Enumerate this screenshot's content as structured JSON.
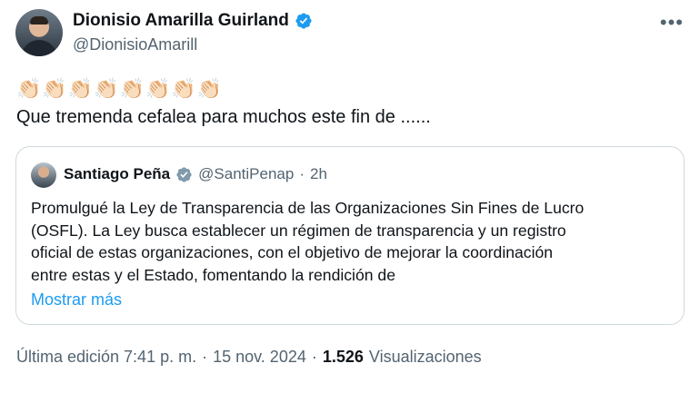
{
  "author": {
    "name": "Dionisio Amarilla Guirland",
    "handle": "@DionisioAmarill"
  },
  "tweet": {
    "emojis": "👏🏻👏🏻👏🏻👏🏻👏🏻👏🏻👏🏻👏🏻",
    "text": "Que tremenda cefalea para muchos este fin de ......"
  },
  "quote": {
    "name": "Santiago Peña",
    "handle": "@SantiPenap",
    "dot": "·",
    "time": "2h",
    "lines": [
      "Promulgué la Ley de Transparencia de las Organizaciones Sin Fines de Lucro",
      "(OSFL). La Ley busca establecer un régimen de transparencia y un registro",
      "oficial de estas organizaciones, con el objetivo de mejorar la coordinación",
      "entre estas y el Estado, fomentando la rendición de"
    ],
    "show_more": "Mostrar más"
  },
  "meta": {
    "edited": "Última edición 7:41 p. m.",
    "sep1": "·",
    "date": "15 nov. 2024",
    "sep2": "·",
    "views_count": "1.526",
    "views_label": "Visualizaciones"
  },
  "colors": {
    "verified_blue": "#1d9bf0",
    "verified_gray": "#829aab",
    "link_blue": "#1d9bf0",
    "secondary_text": "#536471"
  },
  "icons": {
    "more": "more-horizontal-icon",
    "verified": "verified-badge-icon"
  }
}
